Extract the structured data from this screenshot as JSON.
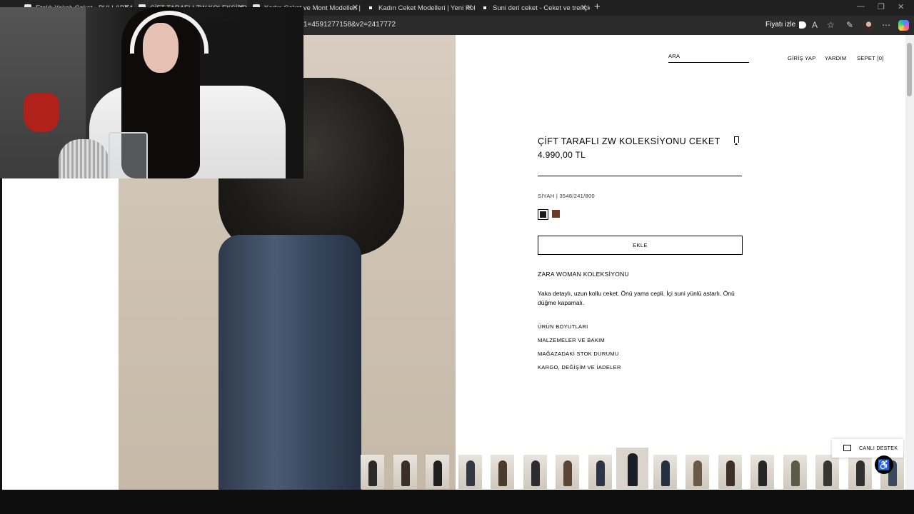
{
  "browser": {
    "tabs": [
      {
        "title": "Eteklı Yakalı Ceket - PULL&BEAR",
        "active": false
      },
      {
        "title": "ÇİFT TARAFLI ZW KOLEKSİYONU",
        "active": true
      },
      {
        "title": "Kadın Ceket ve Mont Modelleri |",
        "active": false
      },
      {
        "title": "Kadın Ceket Modelleri | Yeni Kolek",
        "active": false
      },
      {
        "title": "Suni deri ceket - Ceket ve trençk",
        "active": false
      }
    ],
    "url_fragment": "1=4591277158&v2=2417772",
    "price_track_label": "Fiyatı izle"
  },
  "header": {
    "search_label": "ARA",
    "login": "GİRİŞ YAP",
    "help": "YARDIM",
    "cart": "SEPET [0]"
  },
  "product": {
    "title": "ÇİFT TARAFLI ZW KOLEKSİYONU CEKET",
    "price": "4.990,00 TL",
    "color_code": "SİYAH | 3548/241/800",
    "swatches": [
      {
        "color": "#1a1a1a",
        "selected": true
      },
      {
        "color": "#6b3a28",
        "selected": false
      }
    ],
    "add_label": "EKLE",
    "collection": "ZARA WOMAN KOLEKSİYONU",
    "description": "Yaka detaylı, uzun kollu ceket. Önü yama cepli. İçi suni yünlü astarlı. Önü düğme kapamalı.",
    "links": [
      "ÜRÜN BOYUTLARI",
      "MALZEMELER VE BAKIM",
      "MAĞAZADAKİ STOK DURUMU",
      "KARGO, DEĞİŞİM VE İADELER"
    ]
  },
  "thumbnails": [
    {
      "figure_color": "#2a2a2a"
    },
    {
      "figure_color": "#3a2f28"
    },
    {
      "figure_color": "#1f1f1f"
    },
    {
      "figure_color": "#333844"
    },
    {
      "figure_color": "#4a3c2c"
    },
    {
      "figure_color": "#2c2c30"
    },
    {
      "figure_color": "#5a4636"
    },
    {
      "figure_color": "#2b3446"
    },
    {
      "figure_color": "#1b1d24",
      "active": true
    },
    {
      "figure_color": "#243040"
    },
    {
      "figure_color": "#6b5a48"
    },
    {
      "figure_color": "#3e3028"
    },
    {
      "figure_color": "#262626"
    },
    {
      "figure_color": "#5a5a48"
    },
    {
      "figure_color": "#383630"
    },
    {
      "figure_color": "#2f2f2f"
    },
    {
      "figure_color": "#3b4a5a"
    }
  ],
  "support": {
    "live_chat": "CANLI DESTEK"
  }
}
